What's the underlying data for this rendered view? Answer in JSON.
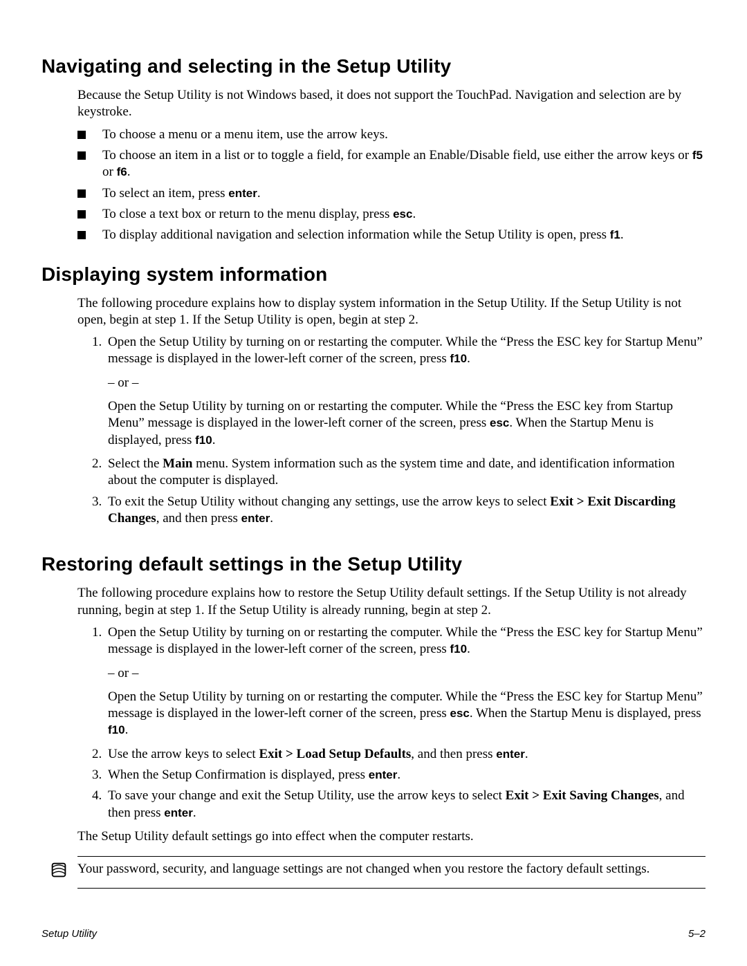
{
  "sections": {
    "navigating": {
      "heading": "Navigating and selecting in the Setup Utility",
      "intro": "Because the Setup Utility is not Windows based, it does not support the TouchPad. Navigation and selection are by keystroke.",
      "bullets": {
        "b1": "To choose a menu or a menu item, use the arrow keys.",
        "b2_a": "To choose an item in a list or to toggle a field, for example an Enable/Disable field, use either the arrow keys or ",
        "b2_key1": "f5",
        "b2_mid": " or ",
        "b2_key2": "f6",
        "b2_end": ".",
        "b3_a": "To select an item, press ",
        "b3_key": "enter",
        "b3_end": ".",
        "b4_a": "To close a text box or return to the menu display, press ",
        "b4_key": "esc",
        "b4_end": ".",
        "b5_a": "To display additional navigation and selection information while the Setup Utility is open, press ",
        "b5_key": "f1",
        "b5_end": "."
      }
    },
    "displaying": {
      "heading": "Displaying system information",
      "intro": "The following procedure explains how to display system information in the Setup Utility. If the Setup Utility is not open, begin at step 1. If the Setup Utility is open, begin at step 2.",
      "steps": {
        "s1_a": "Open the Setup Utility by turning on or restarting the computer. While the “Press the ESC key for Startup Menu” message is displayed in the lower-left corner of the screen, press ",
        "s1_key": "f10",
        "s1_end": ".",
        "s1_or": "– or –",
        "s1b_a": "Open the Setup Utility by turning on or restarting the computer. While the “Press the ESC key from Startup Menu” message is displayed in the lower-left corner of the screen, press ",
        "s1b_key": "esc",
        "s1b_mid": ". When the Startup Menu is displayed, press ",
        "s1b_key2": "f10",
        "s1b_end": ".",
        "s2_a": "Select the ",
        "s2_bold": "Main",
        "s2_b": " menu. System information such as the system time and date, and identification information about the computer is displayed.",
        "s3_a": "To exit the Setup Utility without changing any settings, use the arrow keys to select ",
        "s3_bold": "Exit > Exit Discarding Changes",
        "s3_b": ", and then press ",
        "s3_key": "enter",
        "s3_end": "."
      }
    },
    "restoring": {
      "heading": "Restoring default settings in the Setup Utility",
      "intro": "The following procedure explains how to restore the Setup Utility default settings. If the Setup Utility is not already running, begin at step 1. If the Setup Utility is already running, begin at step 2.",
      "steps": {
        "s1_a": "Open the Setup Utility by turning on or restarting the computer. While the “Press the ESC key for Startup Menu” message is displayed in the lower-left corner of the screen, press ",
        "s1_key": "f10",
        "s1_end": ".",
        "s1_or": "– or –",
        "s1b_a": "Open the Setup Utility by turning on or restarting the computer. While the “Press the ESC key for Startup Menu” message is displayed in the lower-left corner of the screen, press ",
        "s1b_key": "esc",
        "s1b_mid": ". When the Startup Menu is displayed, press ",
        "s1b_key2": "f10",
        "s1b_end": ".",
        "s2_a": "Use the arrow keys to select ",
        "s2_bold": "Exit > Load Setup Defaults",
        "s2_b": ", and then press ",
        "s2_key": "enter",
        "s2_end": ".",
        "s3_a": "When the Setup Confirmation is displayed, press ",
        "s3_key": "enter",
        "s3_end": ".",
        "s4_a": "To save your change and exit the Setup Utility, use the arrow keys to select ",
        "s4_bold": "Exit > Exit Saving Changes",
        "s4_b": ", and then press ",
        "s4_key": "enter",
        "s4_end": "."
      },
      "after": "The Setup Utility default settings go into effect when the computer restarts.",
      "note": "Your password, security, and language settings are not changed when you restore the factory default settings."
    }
  },
  "footer": {
    "left": "Setup Utility",
    "right": "5–2"
  }
}
